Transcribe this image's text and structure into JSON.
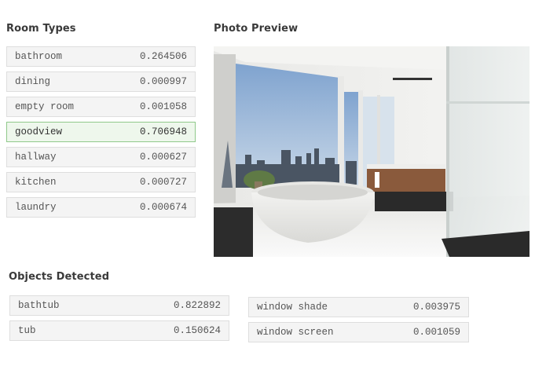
{
  "room_types": {
    "title": "Room Types",
    "items": [
      {
        "label": "bathroom",
        "value": "0.264506"
      },
      {
        "label": "dining",
        "value": "0.000997"
      },
      {
        "label": "empty room",
        "value": "0.001058"
      },
      {
        "label": "goodview",
        "value": "0.706948",
        "highlight": true
      },
      {
        "label": "hallway",
        "value": "0.000627"
      },
      {
        "label": "kitchen",
        "value": "0.000727"
      },
      {
        "label": "laundry",
        "value": "0.000674"
      }
    ]
  },
  "photo_preview": {
    "title": "Photo Preview"
  },
  "objects_detected": {
    "title": "Objects Detected",
    "left": [
      {
        "label": "bathtub",
        "value": "0.822892"
      },
      {
        "label": "tub",
        "value": "0.150624"
      }
    ],
    "right": [
      {
        "label": "window shade",
        "value": "0.003975"
      },
      {
        "label": "window screen",
        "value": "0.001059"
      }
    ]
  },
  "colors": {
    "highlight_bg": "#eef7ec",
    "highlight_border": "#8fc98a",
    "row_bg": "#f4f4f4"
  }
}
